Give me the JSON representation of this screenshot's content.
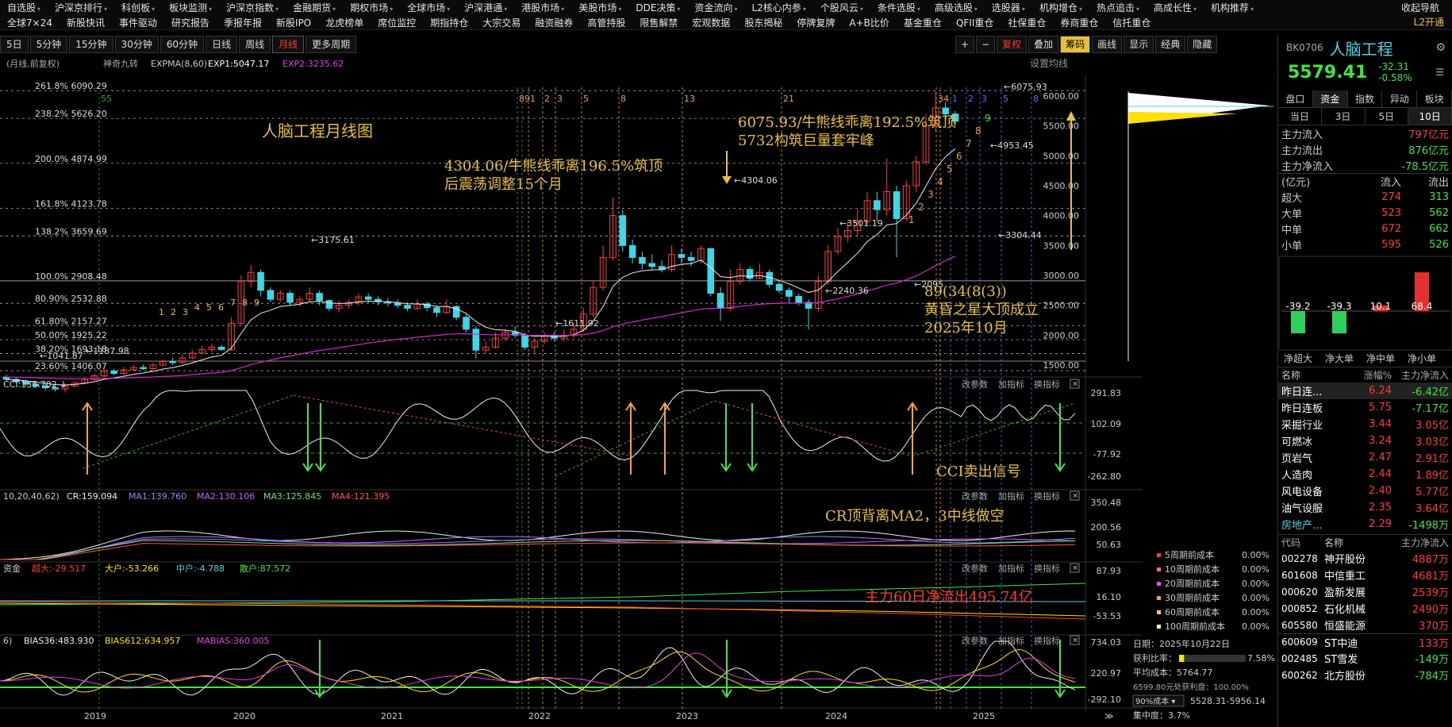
{
  "menubar": {
    "row1": [
      "自选股",
      "沪深京排行",
      "科创板",
      "板块监测",
      "沪深京指数",
      "金融期货",
      "期权市场",
      "全球市场",
      "沪深港通",
      "港股市场",
      "美股市场",
      "DDE决策",
      "资金流向",
      "L2核心内参",
      "个股风云",
      "条件选股",
      "高级选股",
      "选股器",
      "机构增仓",
      "热点追击",
      "高成长性",
      "机构推荐"
    ],
    "row2": [
      "全球7×24",
      "新股快讯",
      "事件驱动",
      "研究报告",
      "季报年报",
      "新股IPO",
      "龙虎榜单",
      "席位监控",
      "期指持仓",
      "大宗交易",
      "融资融券",
      "高管持股",
      "限售解禁",
      "宏观数据",
      "股东揭秘",
      "停牌复牌",
      "A+B比价",
      "基金重仓",
      "QFII重仓",
      "社保重仓",
      "券商重仓",
      "信托重仓"
    ],
    "right": {
      "back": "收起导航",
      "l2": "L2开通"
    }
  },
  "toolbar": {
    "periods": [
      "5日",
      "5分钟",
      "15分钟",
      "30分钟",
      "60分钟",
      "日线",
      "周线",
      "月线",
      "更多周期"
    ],
    "active": "月线",
    "right": [
      "+",
      "−",
      "复权",
      "叠加",
      "筹码",
      "画线",
      "显示",
      "经典",
      "隐藏"
    ]
  },
  "main": {
    "legend": {
      "mode": "(月线,前复权)",
      "name": "神奇九转",
      "expma": "EXPMA(8,60)",
      "exp1": "EXP1:5047.17",
      "exp2": "EXP2:3235.62"
    },
    "settings": "设置均线",
    "fib": [
      {
        "label": "261.8% 6090.29",
        "v": 6090.29
      },
      {
        "label": "238.2% 5626.20",
        "v": 5626.2
      },
      {
        "label": "200.0% 4874.99",
        "v": 4874.99
      },
      {
        "label": "161.8% 4123.78",
        "v": 4123.78
      },
      {
        "label": "138.2% 3659.69",
        "v": 3659.69
      },
      {
        "label": "100.0% 2908.48",
        "v": 2908.48
      },
      {
        "label": "80.90% 2532.88",
        "v": 2532.88
      },
      {
        "label": "61.80% 2157.27",
        "v": 2157.27
      },
      {
        "label": "50.00% 1925.22",
        "v": 1925.22
      },
      {
        "label": "38.20% 1693.18",
        "v": 1693.18
      },
      {
        "label": "23.60% 1406.07",
        "v": 1406.07
      }
    ],
    "price_axis": [
      "6000.00",
      "5500.00",
      "5000.00",
      "4500.00",
      "4000.00",
      "3500.00",
      "3000.00",
      "2500.00",
      "2000.00",
      "1500.00"
    ],
    "annotations": {
      "title": "人脑工程月线图",
      "a1_line1": "4304.06/牛熊线乖离196.5%筑顶",
      "a1_line2": "后震荡调整15个月",
      "a2_line1": "6075.93/牛熊线乖离192.5%筑顶",
      "a2_line2": "5732构筑巨量套牢峰",
      "a3_line1": "89(34(8(3))",
      "a3_line2": "黄昏之星大顶成立",
      "a3_line3": "2025年10月"
    },
    "price_marks": [
      "6075.93",
      "4953.45",
      "4304.06",
      "3501.19",
      "3304.44",
      "3175.61",
      "2240.36",
      "1611.92",
      "2095",
      "1187.98",
      "1041.87"
    ],
    "nine_counts": [
      "1",
      "2",
      "3",
      "4",
      "5",
      "6",
      "7",
      "8",
      "9"
    ],
    "fib_time_labels": [
      "89",
      "1",
      "2",
      "3",
      "5",
      "8",
      "13",
      "21",
      "34",
      "1",
      "2",
      "3",
      "5",
      "8",
      "55"
    ]
  },
  "cci": {
    "legend": "CCI:135.702",
    "axis": [
      "291.83",
      "102.09",
      "-77.92",
      "-262.80"
    ],
    "note": "CCI卖出信号"
  },
  "cr": {
    "legend": {
      "params": "10,20,40,62)",
      "cr": "CR:159.094",
      "ma1": "MA1:139.760",
      "ma2": "MA2:130.106",
      "ma3": "MA3:125.845",
      "ma4": "MA4:121.395"
    },
    "axis": [
      "350.48",
      "200.56",
      "50.63"
    ],
    "note": "CR顶背离MA2，3中线做空"
  },
  "flow": {
    "legend": {
      "t": "资金",
      "big": "超大:-29.517",
      "large": "大户:-53.266",
      "mid": "中户:-4.788",
      "small": "散户:87.572"
    },
    "axis": [
      "87.93",
      "16.10",
      "-53.53"
    ],
    "note": "主力60日净流出495.74亿"
  },
  "bias": {
    "legend": {
      "p": "6)",
      "b36": "BIAS36:483.930",
      "b612": "BIAS612:634.957",
      "mabias": "MABIAS:360.005"
    },
    "axis": [
      "734.03",
      "220.97",
      "-292.10"
    ]
  },
  "panel_buttons": {
    "p": "改参数",
    "i": "加指标",
    "s": "换指标"
  },
  "x_axis": [
    "2019",
    "2020",
    "2021",
    "2022",
    "2023",
    "2024",
    "2025"
  ],
  "cost": {
    "items": [
      {
        "label": "5周期前成本",
        "v": "0.00%",
        "color": "#ff3a3a"
      },
      {
        "label": "10周期前成本",
        "v": "0.00%",
        "color": "#ff6a6a"
      },
      {
        "label": "20周期前成本",
        "v": "0.00%",
        "color": "#ff3aff"
      },
      {
        "label": "30周期前成本",
        "v": "0.00%",
        "color": "#ffa03a"
      },
      {
        "label": "60周期前成本",
        "v": "0.00%",
        "color": "#ffd03a"
      },
      {
        "label": "100周期前成本",
        "v": "0.00%",
        "color": "#ffff9a"
      }
    ],
    "date": "日期：2025年10月22日",
    "profit_label": "获利比率：",
    "profit_pct": "7.58%",
    "profit_fill": 0.0758,
    "avg": "平均成本：5764.77",
    "hint": "6599.80元处获利盘：100.00%",
    "select": "90%成本",
    "range": "5528.31-5956.14",
    "conc": "集中度：3.7%"
  },
  "side": {
    "code": "BK0706",
    "name": "人脑工程",
    "price": "5579.41",
    "chg": "-32.31",
    "chg_pct": "-0.58%",
    "tabs1": [
      "盘口",
      "资金",
      "指数",
      "异动",
      "板块"
    ],
    "tabs2": [
      "当日",
      "3日",
      "5日",
      "10日"
    ],
    "flows": [
      {
        "l": "主力流入",
        "v": "797亿元"
      },
      {
        "l": "主力流出",
        "v": "876亿元"
      },
      {
        "l": "主力净流入",
        "v": "-78.5亿元"
      }
    ],
    "table_head": [
      "(亿元)",
      "流入",
      "流出"
    ],
    "table": [
      {
        "l": "超大",
        "i": "274",
        "o": "313"
      },
      {
        "l": "大单",
        "i": "523",
        "o": "562"
      },
      {
        "l": "中单",
        "i": "672",
        "o": "662"
      },
      {
        "l": "小单",
        "i": "595",
        "o": "526"
      }
    ],
    "bars": [
      {
        "l": "净超大",
        "v": -39.2,
        "t": "-39.2"
      },
      {
        "l": "净大单",
        "v": -39.3,
        "t": "-39.3"
      },
      {
        "l": "净中单",
        "v": 10.1,
        "t": "10.1"
      },
      {
        "l": "净小单",
        "v": 68.4,
        "t": "68.4"
      }
    ],
    "list_head": [
      "名称",
      "涨幅%",
      "主力净流入"
    ],
    "list": [
      {
        "n": "昨日连...",
        "p": "6.24",
        "f": "-6.42亿"
      },
      {
        "n": "昨日连板",
        "p": "5.75",
        "f": "-7.17亿"
      },
      {
        "n": "采掘行业",
        "p": "3.44",
        "f": "3.05亿"
      },
      {
        "n": "可燃冰",
        "p": "3.24",
        "f": "3.03亿"
      },
      {
        "n": "页岩气",
        "p": "2.47",
        "f": "2.91亿"
      },
      {
        "n": "人造肉",
        "p": "2.44",
        "f": "1.89亿"
      },
      {
        "n": "风电设备",
        "p": "2.40",
        "f": "5.77亿"
      },
      {
        "n": "油气设服",
        "p": "2.35",
        "f": "3.64亿"
      },
      {
        "n": "房地产...",
        "p": "2.29",
        "f": "-1498万"
      }
    ],
    "stock_head": [
      "代码",
      "名称",
      "主力净流入"
    ],
    "stocks": [
      {
        "c": "002278",
        "n": "神开股份",
        "f": "4887万"
      },
      {
        "c": "601608",
        "n": "中信重工",
        "f": "4681万"
      },
      {
        "c": "000620",
        "n": "盈新发展",
        "f": "2539万"
      },
      {
        "c": "000852",
        "n": "石化机械",
        "f": "2490万"
      },
      {
        "c": "605580",
        "n": "恒盛能源",
        "f": "370万"
      },
      {
        "c": "600609",
        "n": "ST中迪",
        "f": "133万"
      },
      {
        "c": "002485",
        "n": "ST雪发",
        "f": "-149万"
      },
      {
        "c": "600262",
        "n": "北方股份",
        "f": "-784万"
      }
    ]
  }
}
